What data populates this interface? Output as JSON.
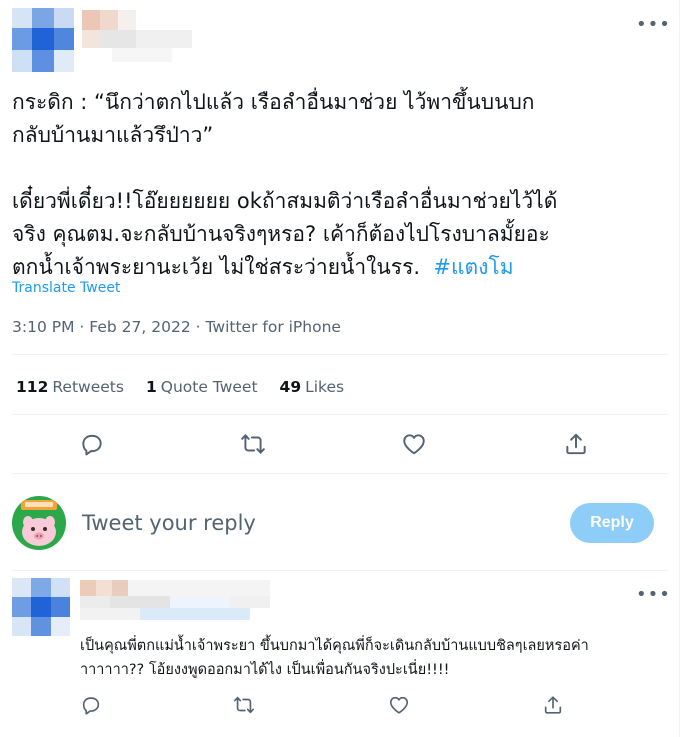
{
  "tweet": {
    "text_line1": "กระดิก : “นึกว่าตกไปแล้ว เรือลำอื่นมาช่วย ไว้พาขึ้นบนบก",
    "text_line2": "กลับบ้านมาแล้วรึป่าว”",
    "text_line3": "เดี๋ยวพี่เดี๋ยว!!โอ๊ยยยยยย okถ้าสมมติว่าเรือลำอื่นมาช่วยไว้ได้",
    "text_line4": "จริง คุณตม.จะกลับบ้านจริงๆหรอ? เค้าก็ต้องไปโรงบาลมั้ยอะ",
    "text_line5": "ตกน้ำเจ้าพระยานะเว้ย ไม่ใช่สระว่ายน้ำในรร.",
    "hashtag": "#แตงโม",
    "translate_label": "Translate Tweet",
    "time": "3:10 PM",
    "date": "Feb 27, 2022",
    "source": "Twitter for iPhone",
    "sep": "·"
  },
  "stats": {
    "retweets_count": "112",
    "retweets_label": "Retweets",
    "quotes_count": "1",
    "quotes_label": "Quote Tweet",
    "likes_count": "49",
    "likes_label": "Likes"
  },
  "compose": {
    "placeholder": "Tweet your reply",
    "button_label": "Reply"
  },
  "reply": {
    "text_line1": "เป็นคุณพี่ตกแม่น้ำเจ้าพระยา ขึ้นบกมาได้คุณพี่ก็จะเดินกลับบ้านแบบชิลๆเลยหรอค่า",
    "text_line2": "าาาาาา?? โอ้ยงงพูดออกมาได้ไง เป็นเพื่อนกันจริงปะเนี่ย!!!!"
  },
  "icons": {
    "more": "more-icon",
    "reply": "reply-icon",
    "retweet": "retweet-icon",
    "like": "heart-icon",
    "share": "share-icon"
  },
  "colors": {
    "accent": "#1d9bf0",
    "muted": "#536471",
    "reply_button_disabled": "#8ecdf8",
    "avatar_bg": "#2aa84a"
  }
}
